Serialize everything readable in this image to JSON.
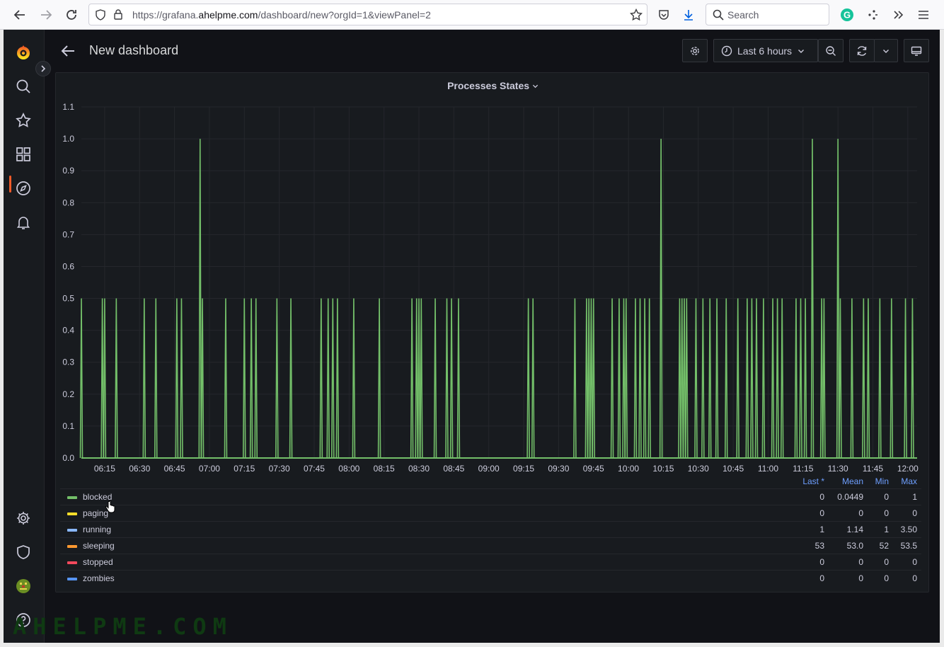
{
  "browser": {
    "url_prefix": "https://grafana.",
    "url_domain": "ahelpme.com",
    "url_path": "/dashboard/new?orgId=1&viewPanel=2",
    "search_placeholder": "Search"
  },
  "header": {
    "title": "New dashboard",
    "time_range": "Last 6 hours"
  },
  "sidebar": {
    "items": [
      {
        "icon": "grafana-logo-icon"
      },
      {
        "icon": "search-icon"
      },
      {
        "icon": "star-icon"
      },
      {
        "icon": "dashboards-icon",
        "active": true
      },
      {
        "icon": "explore-compass-icon"
      },
      {
        "icon": "alerting-bell-icon"
      },
      {
        "icon": "configuration-gear-icon"
      },
      {
        "icon": "server-admin-shield-icon"
      },
      {
        "icon": "user-avatar-icon"
      },
      {
        "icon": "help-icon"
      }
    ]
  },
  "panel": {
    "title": "Processes States"
  },
  "chart_data": {
    "type": "line",
    "title": "Processes States",
    "ylim": [
      0,
      1.1
    ],
    "y_ticks": [
      "0.0",
      "0.1",
      "0.2",
      "0.3",
      "0.4",
      "0.5",
      "0.6",
      "0.7",
      "0.8",
      "0.9",
      "1.0",
      "1.1"
    ],
    "x_ticks": [
      "06:15",
      "06:30",
      "06:45",
      "07:00",
      "07:15",
      "07:30",
      "07:45",
      "08:00",
      "08:15",
      "08:30",
      "08:45",
      "09:00",
      "09:15",
      "09:30",
      "09:45",
      "10:00",
      "10:15",
      "10:30",
      "10:45",
      "11:00",
      "11:15",
      "11:30",
      "11:45",
      "12:00"
    ],
    "x_range": [
      "06:05",
      "12:04"
    ],
    "grid": true,
    "series": [
      {
        "name": "blocked",
        "color": "#73bf69",
        "spikes": [
          [
            "06:05",
            0.5
          ],
          [
            "06:14",
            0.5
          ],
          [
            "06:15",
            0.5
          ],
          [
            "06:20",
            0.5
          ],
          [
            "06:32",
            0.5
          ],
          [
            "06:37",
            0.5
          ],
          [
            "06:46",
            0.5
          ],
          [
            "06:48",
            0.5
          ],
          [
            "06:56",
            1.0
          ],
          [
            "06:57",
            0.5
          ],
          [
            "07:07",
            0.5
          ],
          [
            "07:15",
            0.5
          ],
          [
            "07:18",
            0.5
          ],
          [
            "07:20",
            0.5
          ],
          [
            "07:29",
            0.5
          ],
          [
            "07:35",
            0.5
          ],
          [
            "07:48",
            0.5
          ],
          [
            "07:51",
            0.5
          ],
          [
            "07:53",
            0.5
          ],
          [
            "07:55",
            0.5
          ],
          [
            "08:02",
            0.5
          ],
          [
            "08:13",
            0.5
          ],
          [
            "08:27",
            0.5
          ],
          [
            "08:29",
            0.5
          ],
          [
            "08:30",
            0.5
          ],
          [
            "08:31",
            0.5
          ],
          [
            "08:37",
            0.5
          ],
          [
            "08:42",
            0.5
          ],
          [
            "08:44",
            0.5
          ],
          [
            "08:47",
            0.5
          ],
          [
            "09:17",
            0.5
          ],
          [
            "09:19",
            0.5
          ],
          [
            "09:37",
            0.5
          ],
          [
            "09:42",
            0.5
          ],
          [
            "09:43",
            0.5
          ],
          [
            "09:44",
            0.5
          ],
          [
            "09:45",
            0.5
          ],
          [
            "09:53",
            0.5
          ],
          [
            "09:56",
            0.5
          ],
          [
            "09:58",
            0.5
          ],
          [
            "09:59",
            0.5
          ],
          [
            "10:03",
            0.5
          ],
          [
            "10:05",
            0.5
          ],
          [
            "10:07",
            0.5
          ],
          [
            "10:09",
            0.5
          ],
          [
            "10:14",
            1.0
          ],
          [
            "10:22",
            0.5
          ],
          [
            "10:23",
            0.5
          ],
          [
            "10:24",
            0.5
          ],
          [
            "10:25",
            0.5
          ],
          [
            "10:29",
            0.5
          ],
          [
            "10:32",
            0.5
          ],
          [
            "10:35",
            0.5
          ],
          [
            "10:38",
            0.5
          ],
          [
            "10:42",
            0.5
          ],
          [
            "10:47",
            0.5
          ],
          [
            "10:51",
            0.5
          ],
          [
            "10:53",
            0.5
          ],
          [
            "10:55",
            0.5
          ],
          [
            "10:58",
            0.5
          ],
          [
            "11:02",
            0.5
          ],
          [
            "11:04",
            0.5
          ],
          [
            "11:06",
            0.5
          ],
          [
            "11:12",
            0.5
          ],
          [
            "11:14",
            0.5
          ],
          [
            "11:16",
            0.5
          ],
          [
            "11:19",
            1.0
          ],
          [
            "11:23",
            0.5
          ],
          [
            "11:24",
            0.5
          ],
          [
            "11:30",
            1.0
          ],
          [
            "11:31",
            0.5
          ],
          [
            "11:36",
            0.5
          ],
          [
            "11:41",
            0.5
          ],
          [
            "11:43",
            0.5
          ],
          [
            "11:48",
            0.5
          ],
          [
            "11:53",
            0.5
          ],
          [
            "11:59",
            0.5
          ],
          [
            "12:02",
            0.5
          ]
        ]
      }
    ]
  },
  "legend": {
    "headers": [
      "Last *",
      "Mean",
      "Min",
      "Max"
    ],
    "rows": [
      {
        "name": "blocked",
        "color": "#73bf69",
        "last": "0",
        "mean": "0.0449",
        "min": "0",
        "max": "1"
      },
      {
        "name": "paging",
        "color": "#fade2a",
        "last": "0",
        "mean": "0",
        "min": "0",
        "max": "0"
      },
      {
        "name": "running",
        "color": "#8ab8ff",
        "last": "1",
        "mean": "1.14",
        "min": "1",
        "max": "3.50"
      },
      {
        "name": "sleeping",
        "color": "#ff9830",
        "last": "53",
        "mean": "53.0",
        "min": "52",
        "max": "53.5"
      },
      {
        "name": "stopped",
        "color": "#f2495c",
        "last": "0",
        "mean": "0",
        "min": "0",
        "max": "0"
      },
      {
        "name": "zombies",
        "color": "#5794f2",
        "last": "0",
        "mean": "0",
        "min": "0",
        "max": "0"
      }
    ]
  },
  "watermark": "AHELPME.COM"
}
